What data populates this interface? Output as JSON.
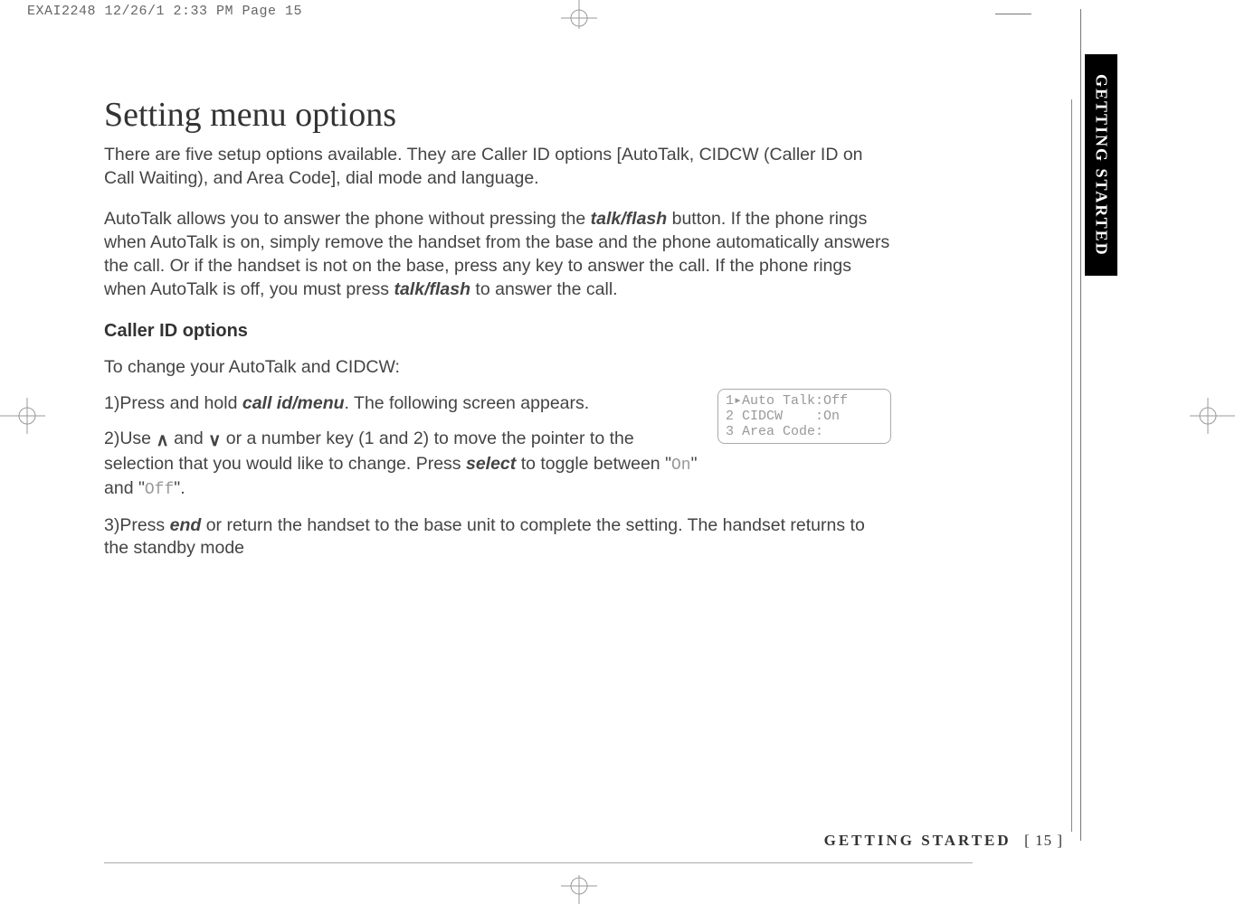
{
  "print_header": "EXAI2248  12/26/1 2:33 PM  Page 15",
  "side_tab": "GETTING STARTED",
  "title": "Setting menu options",
  "intro": "There are five setup options available. They are Caller ID options [AutoTalk, CIDCW (Caller ID on Call Waiting), and Area Code], dial mode and language.",
  "autotalk_desc_pre": "AutoTalk allows you to answer the phone without pressing the ",
  "btn_talkflash": "talk/flash",
  "autotalk_desc_mid": " button. If the phone rings when AutoTalk is on, simply remove the handset from the base and the phone automatically answers the call. Or if the handset is not on the base, press any key to answer the call. If the phone rings when AutoTalk is off, you must press ",
  "autotalk_desc_post": " to answer the call.",
  "subhead": "Caller ID options",
  "lead2": "To change your AutoTalk and CIDCW:",
  "step1_pre": "1)Press and hold ",
  "btn_callid": "call id/menu",
  "step1_post": ". The following screen appears.",
  "step2_pre": "2)Use ",
  "step2_mid": " and ",
  "step2_rest1": " or a number key (1 and 2) to move the pointer to the selection that you would like to change. Press ",
  "btn_select": "select",
  "step2_rest2": " to toggle between \"",
  "lcd_on": "On",
  "step2_rest3": "\" and \"",
  "lcd_off": "Off",
  "step2_rest4": "\".",
  "step3_pre": "3)Press ",
  "btn_end": "end",
  "step3_post": " or return the handset to the base unit to complete the setting. The handset returns to the standby mode",
  "lcd_line1": "1▸Auto Talk:Off",
  "lcd_line2": "2 CIDCW    :On",
  "lcd_line3": "3 Area Code:",
  "footer_section": "GETTING STARTED",
  "footer_page": "[ 15 ]",
  "icons": {
    "up": "∧",
    "down": "∨"
  }
}
